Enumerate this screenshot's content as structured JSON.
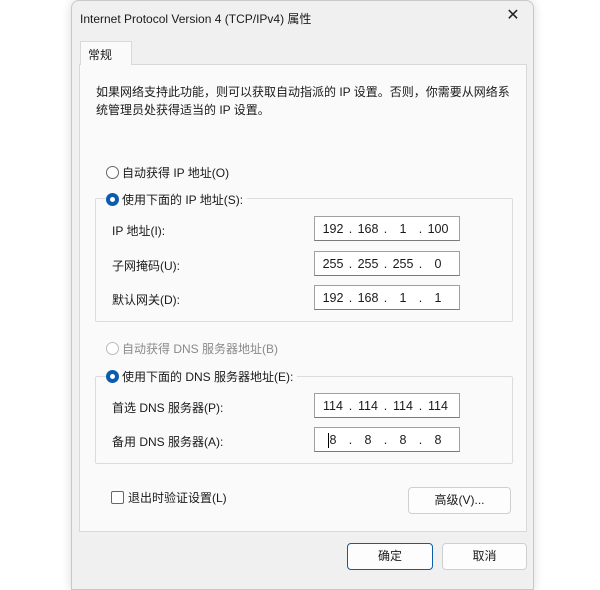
{
  "window": {
    "title": "Internet Protocol Version 4 (TCP/IPv4) 属性",
    "close_icon": "close-icon"
  },
  "tabs": [
    {
      "label": "常规"
    }
  ],
  "description": "如果网络支持此功能，则可以获取自动指派的 IP 设置。否则，你需要从网络系统管理员处获得适当的 IP 设置。",
  "ip": {
    "auto_label": "自动获得 IP 地址(O)",
    "manual_label": "使用下面的 IP 地址(S):",
    "selected": "manual",
    "fields": [
      {
        "label": "IP 地址(I):",
        "octets": [
          "192",
          "168",
          "1",
          "100"
        ]
      },
      {
        "label": "子网掩码(U):",
        "octets": [
          "255",
          "255",
          "255",
          "0"
        ]
      },
      {
        "label": "默认网关(D):",
        "octets": [
          "192",
          "168",
          "1",
          "1"
        ]
      }
    ]
  },
  "dns": {
    "auto_label": "自动获得 DNS 服务器地址(B)",
    "manual_label": "使用下面的 DNS 服务器地址(E):",
    "selected": "manual",
    "fields": [
      {
        "label": "首选 DNS 服务器(P):",
        "octets": [
          "114",
          "114",
          "114",
          "114"
        ]
      },
      {
        "label": "备用 DNS 服务器(A):",
        "octets": [
          "8",
          "8",
          "8",
          "8"
        ]
      }
    ]
  },
  "validate_label": "退出时验证设置(L)",
  "validate_checked": false,
  "advanced_label": "高级(V)...",
  "ok_label": "确定",
  "cancel_label": "取消"
}
